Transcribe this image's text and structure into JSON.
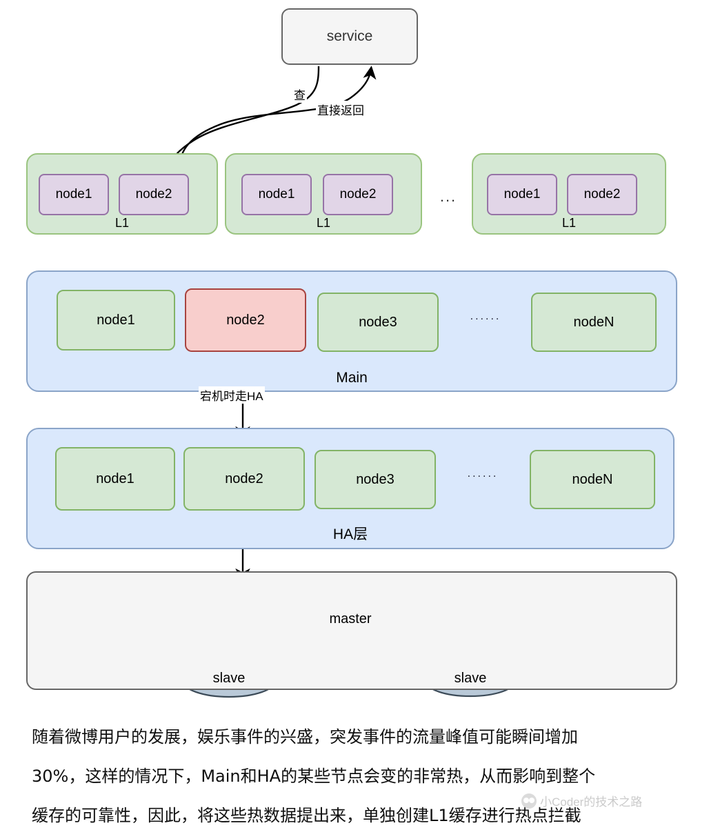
{
  "diagram": {
    "title": "Weibo multi-level cache architecture",
    "service": {
      "label": "service"
    },
    "arrows": {
      "query_label": "查",
      "return_label": "直接返回",
      "failover_label": "宕机时走HA"
    },
    "l1_groups": [
      {
        "label": "L1",
        "nodes": [
          "node1",
          "node2"
        ]
      },
      {
        "label": "L1",
        "nodes": [
          "node1",
          "node2"
        ]
      },
      {
        "label": "L1",
        "nodes": [
          "node1",
          "node2"
        ]
      }
    ],
    "l1_ellipsis": "...",
    "main_layer": {
      "label": "Main",
      "nodes": [
        "node1",
        "node2",
        "node3",
        "nodeN"
      ],
      "ellipsis": "......",
      "hot_node": "node2"
    },
    "ha_layer": {
      "label": "HA层",
      "nodes": [
        "node1",
        "node2",
        "node3",
        "nodeN"
      ],
      "ellipsis": "......"
    },
    "db_layer": {
      "cylinders": [
        {
          "label": "master"
        },
        {
          "label": "slave"
        },
        {
          "label": "slave"
        }
      ]
    },
    "colors": {
      "service_fill": "#f5f5f5",
      "service_stroke": "#666666",
      "l1_group_fill": "#d5e8d4",
      "l1_group_stroke": "#9ac47f",
      "l1_node_fill": "#e1d5e7",
      "l1_node_stroke": "#9673a6",
      "layer_fill": "#dae8fc",
      "layer_stroke": "#8aa4c8",
      "node_fill": "#d5e8d4",
      "node_stroke": "#82b366",
      "hot_node_fill": "#f8cecc",
      "hot_node_stroke": "#a8433f",
      "db_fill": "#f5f5f5",
      "db_stroke": "#666666",
      "cylinder_fill": "#b9c9d8",
      "cylinder_stroke": "#3b4a57"
    }
  },
  "paragraph": {
    "lines": [
      "随着微博用户的发展，娱乐事件的兴盛，突发事件的流量峰值可能瞬间增加",
      "30%，这样的情况下，Main和HA的某些节点会变的非常热，从而影响到整个",
      "缓存的可靠性，因此，将这些热数据提出来，单独创建L1缓存进行热点拦截"
    ]
  },
  "watermark": {
    "text": "小Coder的技术之路"
  }
}
